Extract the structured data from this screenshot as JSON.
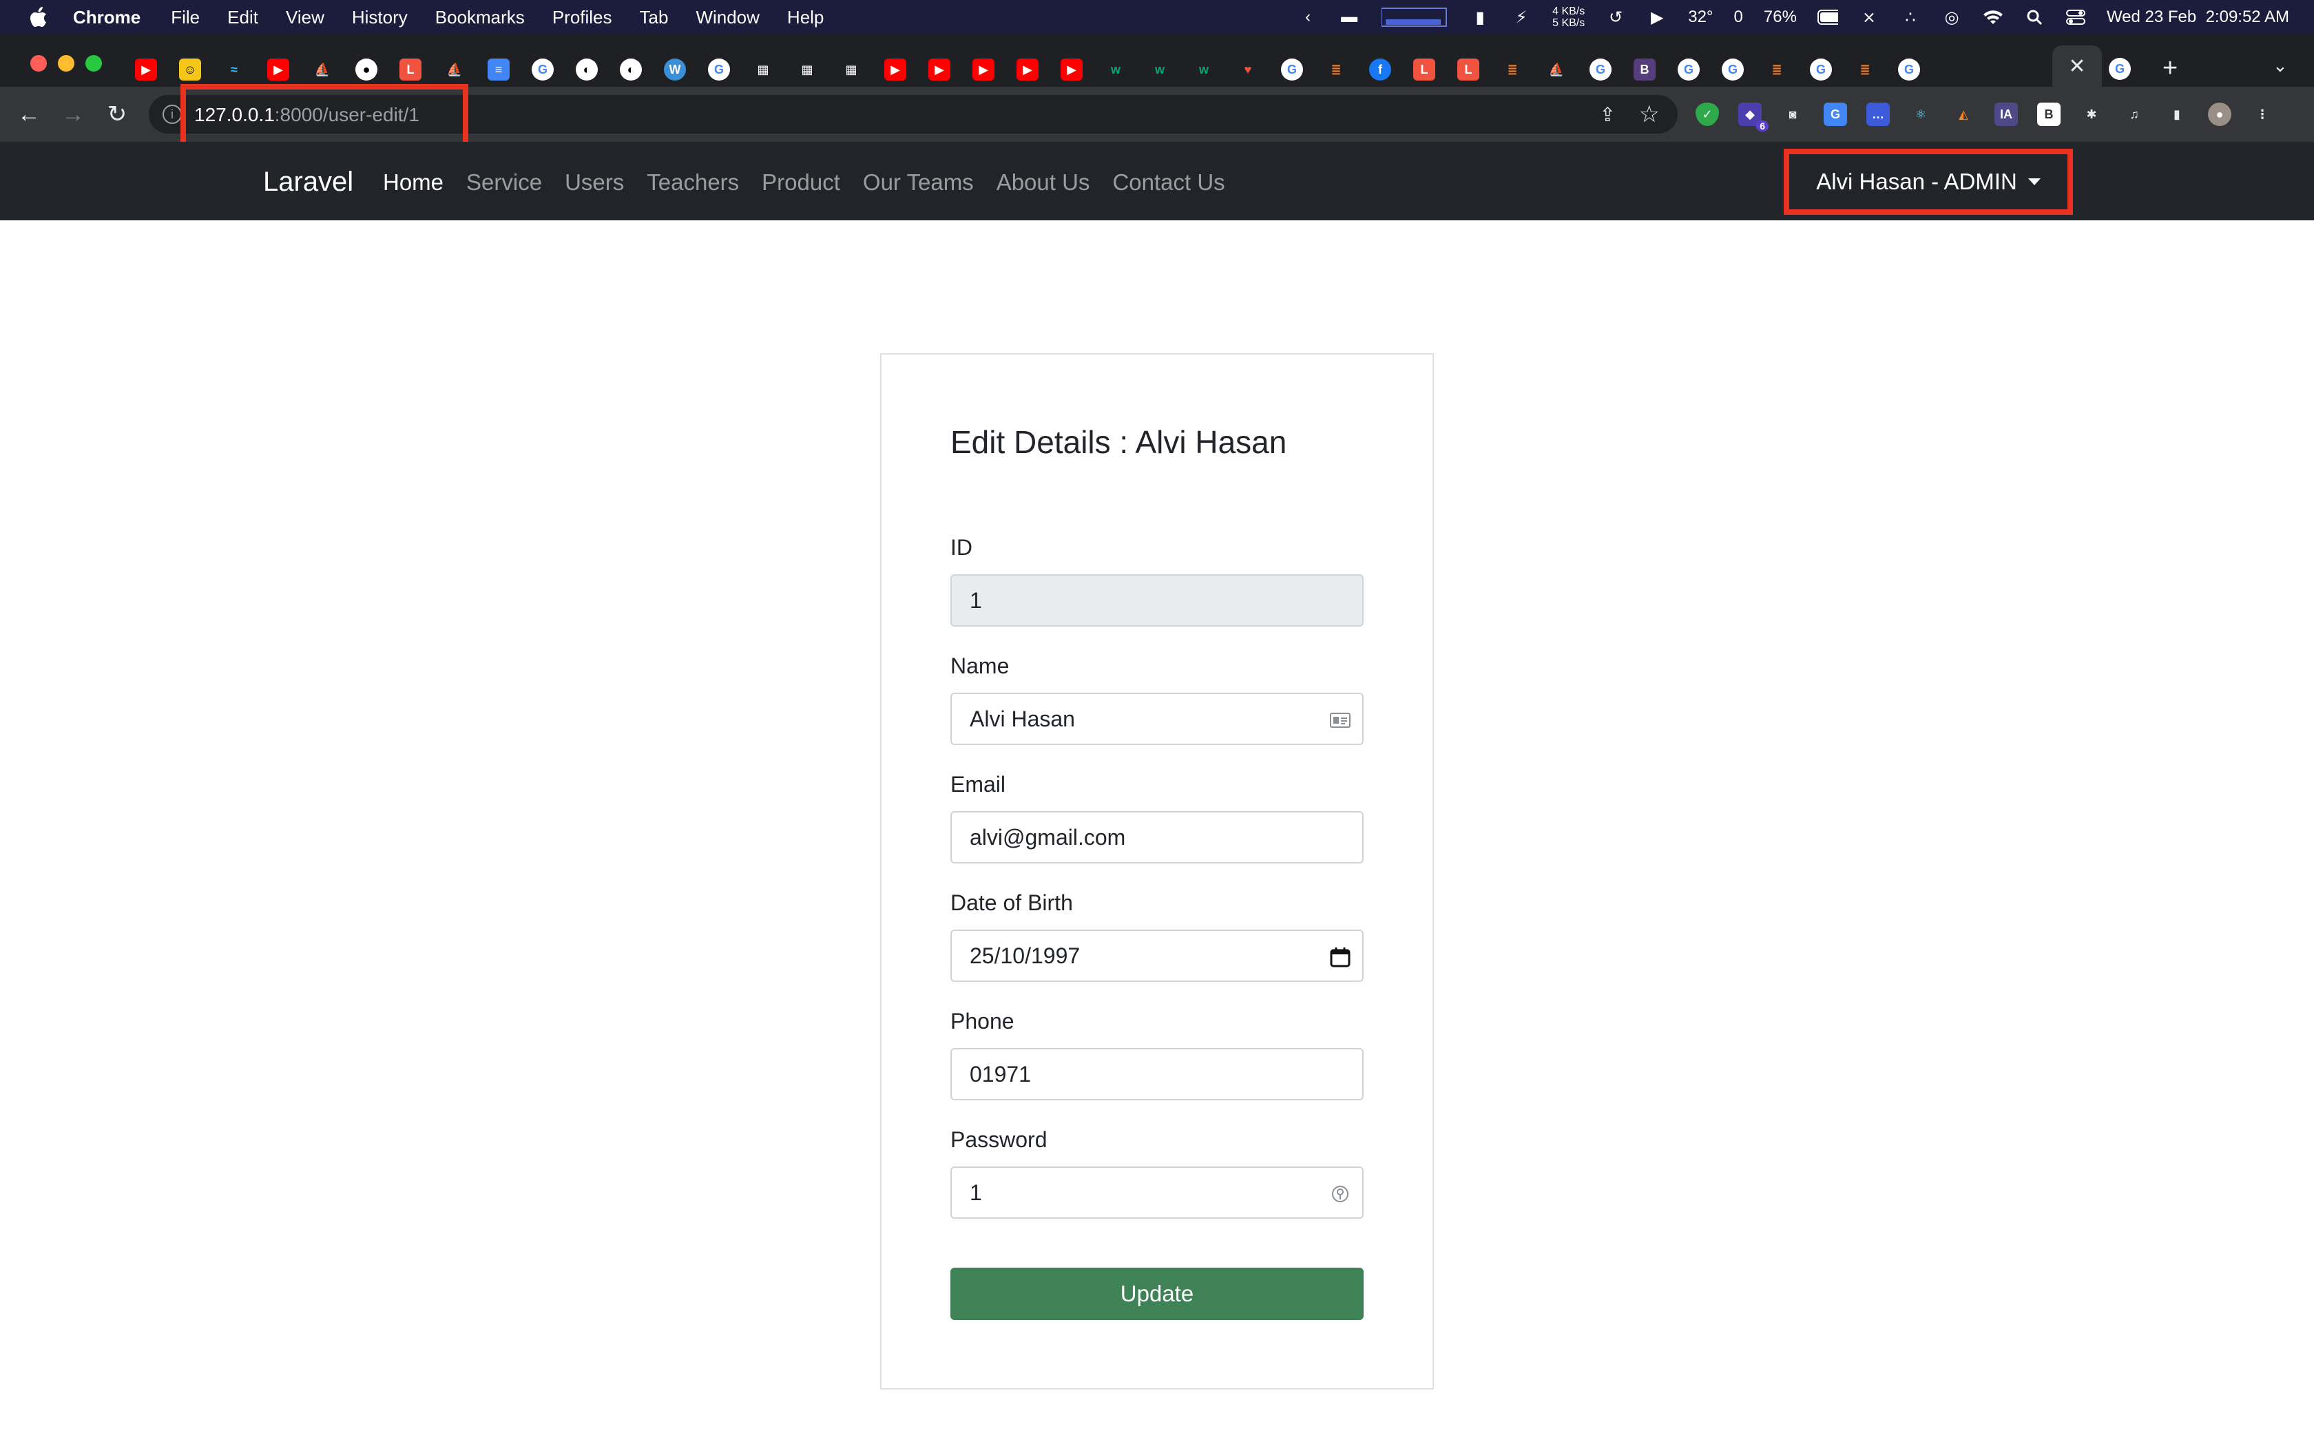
{
  "macos": {
    "menu_items": [
      "Chrome",
      "File",
      "Edit",
      "View",
      "History",
      "Bookmarks",
      "Profiles",
      "Tab",
      "Window",
      "Help"
    ],
    "network_up": "4 KB/s",
    "network_down": "5 KB/s",
    "temperature": "32°",
    "temp_extra": "0",
    "battery": "76%",
    "datetime": "Wed 23 Feb  2:09:52 AM"
  },
  "browser": {
    "active_tab_close": "✕",
    "url_host": "127.0.0.1",
    "url_path": ":8000/user-edit/1",
    "extension_badge": "6",
    "colors": {
      "highlight": "#e8321f"
    }
  },
  "navbar": {
    "brand": "Laravel",
    "links": [
      "Home",
      "Service",
      "Users",
      "Teachers",
      "Product",
      "Our Teams",
      "About Us",
      "Contact Us"
    ],
    "active_link": "Home",
    "user_dropdown": "Alvi Hasan - ADMIN"
  },
  "form": {
    "title": "Edit Details : Alvi Hasan",
    "fields": [
      {
        "label": "ID",
        "value": "1"
      },
      {
        "label": "Name",
        "value": "Alvi Hasan"
      },
      {
        "label": "Email",
        "value": "alvi@gmail.com"
      },
      {
        "label": "Date of Birth",
        "value": "25/10/1997"
      },
      {
        "label": "Phone",
        "value": "01971"
      },
      {
        "label": "Password",
        "value": "1"
      }
    ],
    "submit_label": "Update",
    "colors": {
      "submit": "#3e8255"
    }
  }
}
